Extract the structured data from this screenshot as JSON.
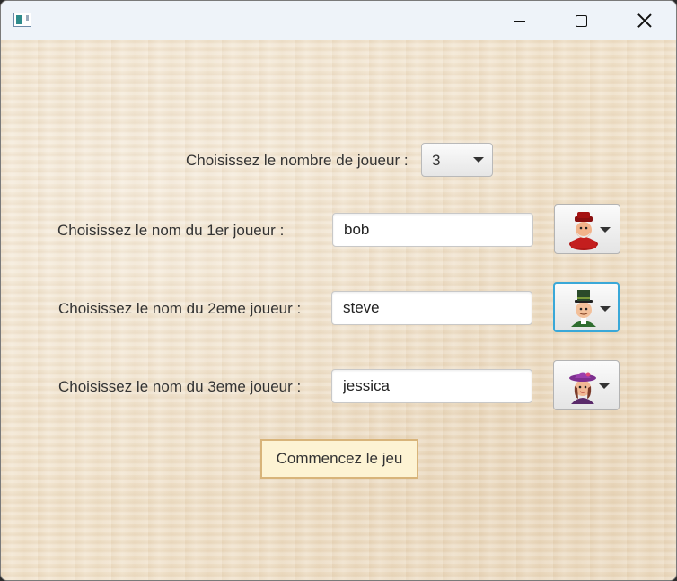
{
  "window": {
    "title": ""
  },
  "player_count": {
    "label": "Choisissez le nombre de joueur :",
    "value": "3"
  },
  "players": [
    {
      "label": "Choisissez le nom du 1er joueur :",
      "name": "bob",
      "avatar": "red-villain-avatar"
    },
    {
      "label": "Choisissez le nom du 2eme joueur :",
      "name": "steve",
      "avatar": "top-hat-gentleman-avatar"
    },
    {
      "label": "Choisissez le nom du 3eme joueur :",
      "name": "jessica",
      "avatar": "purple-hat-lady-avatar"
    }
  ],
  "start_button": {
    "label": "Commencez le jeu"
  }
}
